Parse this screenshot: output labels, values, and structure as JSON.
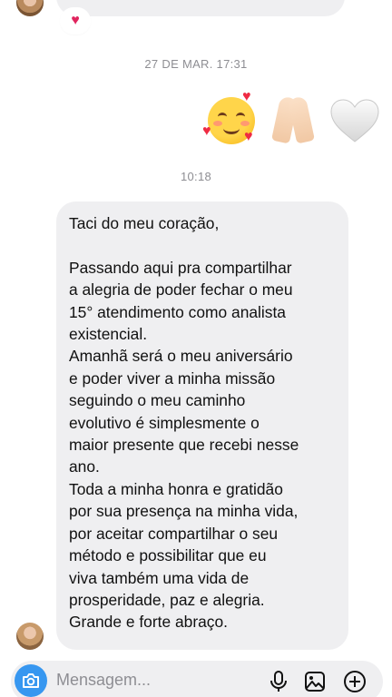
{
  "thread": {
    "top_reaction": "♥",
    "timestamp_1": "27 DE MAR. 17:31",
    "emoji_message": {
      "emojis": [
        "smiling-face-with-hearts",
        "folded-hands",
        "white-heart"
      ]
    },
    "timestamp_2": "10:18",
    "message_lines": [
      "Taci do meu coração,",
      "",
      "Passando aqui pra compartilhar",
      "a alegria de poder fechar o meu",
      "15° atendimento como analista",
      "existencial.",
      "Amanhã será o meu aniversário",
      "e poder viver a minha missão",
      "seguindo o meu caminho",
      "evolutivo é simplesmente o",
      "maior presente que recebi nesse",
      "ano.",
      "Toda a minha honra e gratidão",
      "por sua presença na minha vida,",
      "por aceitar compartilhar o seu",
      "método e possibilitar que eu",
      "viva também uma vida de",
      "prosperidade, paz e alegria.",
      "Grande e forte abraço."
    ]
  },
  "composer": {
    "placeholder": "Mensagem..."
  },
  "colors": {
    "bubble_bg": "#efeff1",
    "accent": "#3797f0",
    "timestamp": "#8e8e93",
    "heart": "#e0245e"
  }
}
